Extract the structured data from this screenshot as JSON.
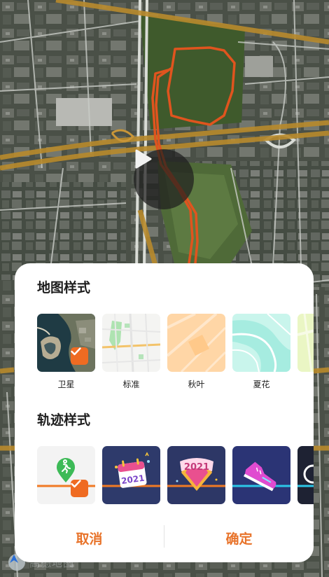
{
  "map_view": {
    "background": "satellite",
    "track_color": "#e0541e"
  },
  "watermark": {
    "text": "高德地图"
  },
  "sheet": {
    "map_style_title": "地图样式",
    "track_style_title": "轨迹样式",
    "map_styles": [
      {
        "label": "卫星",
        "selected": true
      },
      {
        "label": "标准",
        "selected": false
      },
      {
        "label": "秋叶",
        "selected": false
      },
      {
        "label": "夏花",
        "selected": false
      },
      {
        "label": "",
        "selected": false
      }
    ],
    "track_styles": [
      {
        "name": "runner-pin",
        "selected": true
      },
      {
        "name": "calendar-2021",
        "selected": false,
        "text": "2021"
      },
      {
        "name": "badge-2021",
        "selected": false,
        "text": "2021"
      },
      {
        "name": "sneaker",
        "selected": false
      },
      {
        "name": "dark-partial",
        "selected": false
      }
    ],
    "cancel_label": "取消",
    "confirm_label": "确定",
    "accent_color": "#e8732a",
    "check_color": "#ef6b22"
  }
}
